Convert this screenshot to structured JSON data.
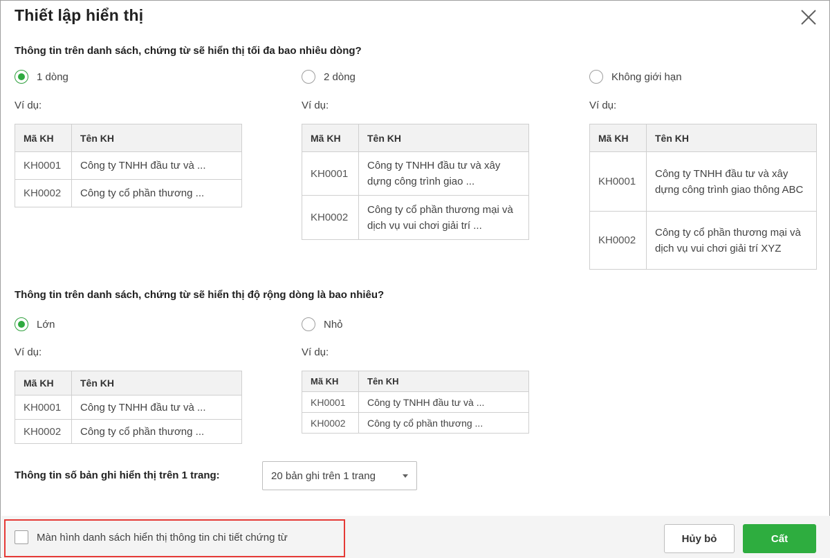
{
  "dialog": {
    "title": "Thiết lập hiển thị",
    "close_icon": "close-icon"
  },
  "line_count": {
    "question": "Thông tin trên danh sách, chứng từ sẽ hiển thị tối đa bao nhiêu dòng?",
    "options": [
      {
        "label": "1 dòng",
        "checked": true
      },
      {
        "label": "2 dòng",
        "checked": false
      },
      {
        "label": "Không giới hạn",
        "checked": false
      }
    ],
    "example_label": "Ví dụ:",
    "table": {
      "headers": [
        "Mã KH",
        "Tên KH"
      ],
      "rows": [
        {
          "code": "KH0001",
          "name_one_line": "Công ty TNHH đầu tư và ...",
          "name_two_line": "Công ty TNHH đầu tư và xây dựng công trình giao ...",
          "name_full": "Công ty TNHH đầu tư và xây dựng công trình giao thông ABC"
        },
        {
          "code": "KH0002",
          "name_one_line": "Công ty cổ phần thương  ...",
          "name_two_line": "Công ty cổ phần thương mại và dịch vụ vui chơi giải trí ...",
          "name_full": "Công ty cổ phần thương mại và dịch vụ vui chơi giải trí XYZ"
        }
      ]
    }
  },
  "row_width": {
    "question": "Thông tin trên danh sách, chứng từ sẽ hiển thị độ rộng dòng là bao nhiêu?",
    "options": [
      {
        "label": "Lớn",
        "checked": true
      },
      {
        "label": "Nhỏ",
        "checked": false
      }
    ],
    "example_label": "Ví dụ:",
    "table": {
      "headers": [
        "Mã KH",
        "Tên KH"
      ],
      "rows": [
        {
          "code": "KH0001",
          "name": "Công ty TNHH đầu tư và ..."
        },
        {
          "code": "KH0002",
          "name": "Công ty cổ phần thương  ..."
        }
      ]
    }
  },
  "records_per_page": {
    "label": "Thông tin số bản ghi hiển thị trên 1 trang:",
    "selected": "20 bản ghi trên 1 trang"
  },
  "footer": {
    "checkbox_label": "Màn hình danh sách hiển thị thông tin chi tiết chứng từ",
    "checkbox_checked": false,
    "cancel_label": "Hủy bỏ",
    "save_label": "Cất",
    "accent_color": "#2ead3f",
    "highlight_color": "#e53935"
  }
}
